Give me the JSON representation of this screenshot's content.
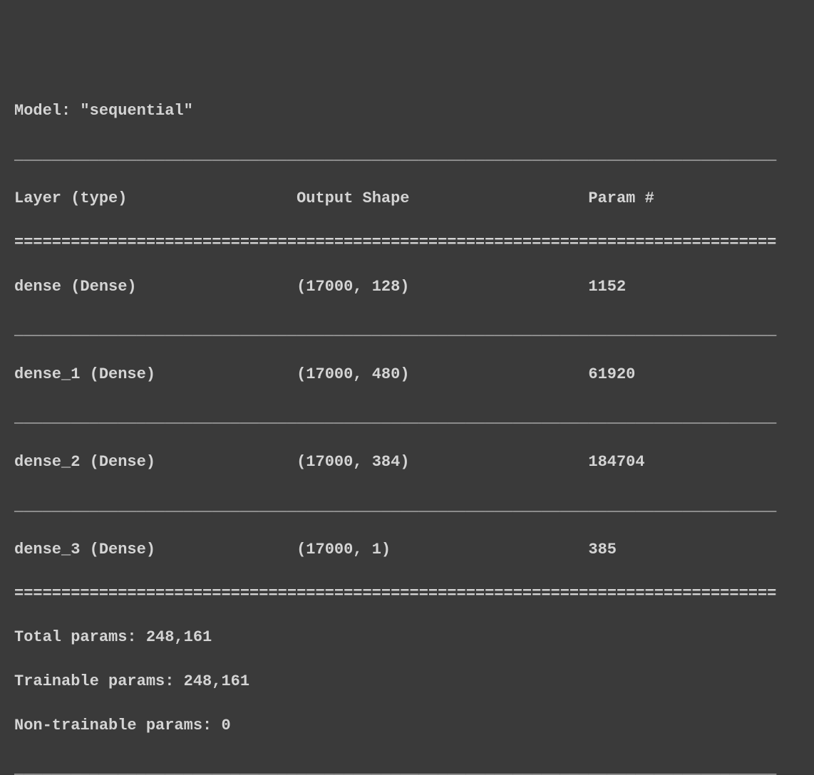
{
  "header": {
    "title": "Model: \"sequential\""
  },
  "divider_thin": "_________________________________________________________________________________",
  "divider_thick": "=================================================================================",
  "columns": {
    "layer": "Layer (type)",
    "output": "Output Shape",
    "param": "Param #"
  },
  "rows": [
    {
      "layer": "dense (Dense)",
      "output": "(17000, 128)",
      "param": "1152"
    },
    {
      "layer": "dense_1 (Dense)",
      "output": "(17000, 480)",
      "param": "61920"
    },
    {
      "layer": "dense_2 (Dense)",
      "output": "(17000, 384)",
      "param": "184704"
    },
    {
      "layer": "dense_3 (Dense)",
      "output": "(17000, 1)",
      "param": "385"
    }
  ],
  "footer": {
    "total": "Total params: 248,161",
    "trainable": "Trainable params: 248,161",
    "nontrainable": "Non-trainable params: 0"
  }
}
